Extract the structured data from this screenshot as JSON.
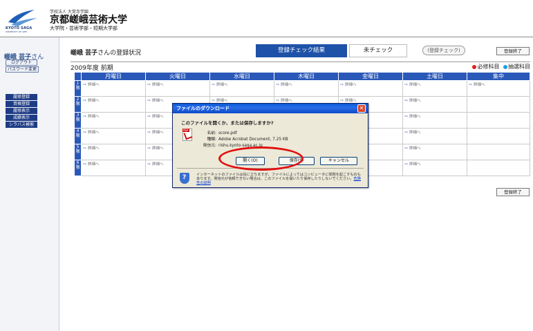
{
  "header": {
    "logo_text": "KYOTO SAGA",
    "logo_sub": "UNIVERSITY OF ARTS",
    "univ_small": "学校法人 大覚寺学園",
    "univ_main": "京都嵯峨芸術大学",
    "univ_sub": "大学院・芸術学部・短期大学部"
  },
  "sidebar": {
    "user": "嵯峨 芸子",
    "user_suffix": "さん",
    "logout": "ログアウト",
    "password": "パスワード変更",
    "menu": [
      "履修登録",
      "資格登録",
      "履修表示",
      "成績表示",
      "シラバス検索"
    ]
  },
  "topbar": {
    "name": "嵯峨 芸子",
    "title_suffix": "さんの登録状況",
    "tab_result": "登録チェック結果",
    "tab_unchecked": "未チェック",
    "btn_check": "(登録チェック)",
    "btn_end": "登録終了"
  },
  "timetable": {
    "term": "2009年度 前期",
    "legend_required": "必修科目",
    "legend_elective": "抽選科目",
    "legend_colors": {
      "required": "#e02020",
      "elective": "#1ea0e0"
    },
    "days": [
      "月曜日",
      "火曜日",
      "水曜日",
      "木曜日",
      "金曜日",
      "土曜日",
      "集中"
    ],
    "periods": [
      "1限",
      "2限",
      "3限",
      "4限",
      "5限",
      "6限"
    ],
    "cell_link": "詳細へ"
  },
  "dialog": {
    "title": "ファイルのダウンロード",
    "question": "このファイルを開くか、または保存しますか?",
    "name_label": "名前:",
    "name_value": "score.pdf",
    "type_label": "種類:",
    "type_value": "Adobe Acrobat Document, 7.25 KB",
    "from_label": "発信元:",
    "from_value": "rishu.kyoto-saga.ac.jp",
    "open_btn": "開く(O)",
    "save_btn": "保存(S)",
    "cancel_btn": "キャンセル",
    "warning": "インターネットのファイルは役に立ちますが、ファイルによってはコンピュータに問題を起こすものもあります。発信元が信頼できない場合は、このファイルを開いたり保存したりしないでください。",
    "warning_link": "危険性の説明"
  },
  "annotation": {
    "ring_color": "#e01010"
  }
}
